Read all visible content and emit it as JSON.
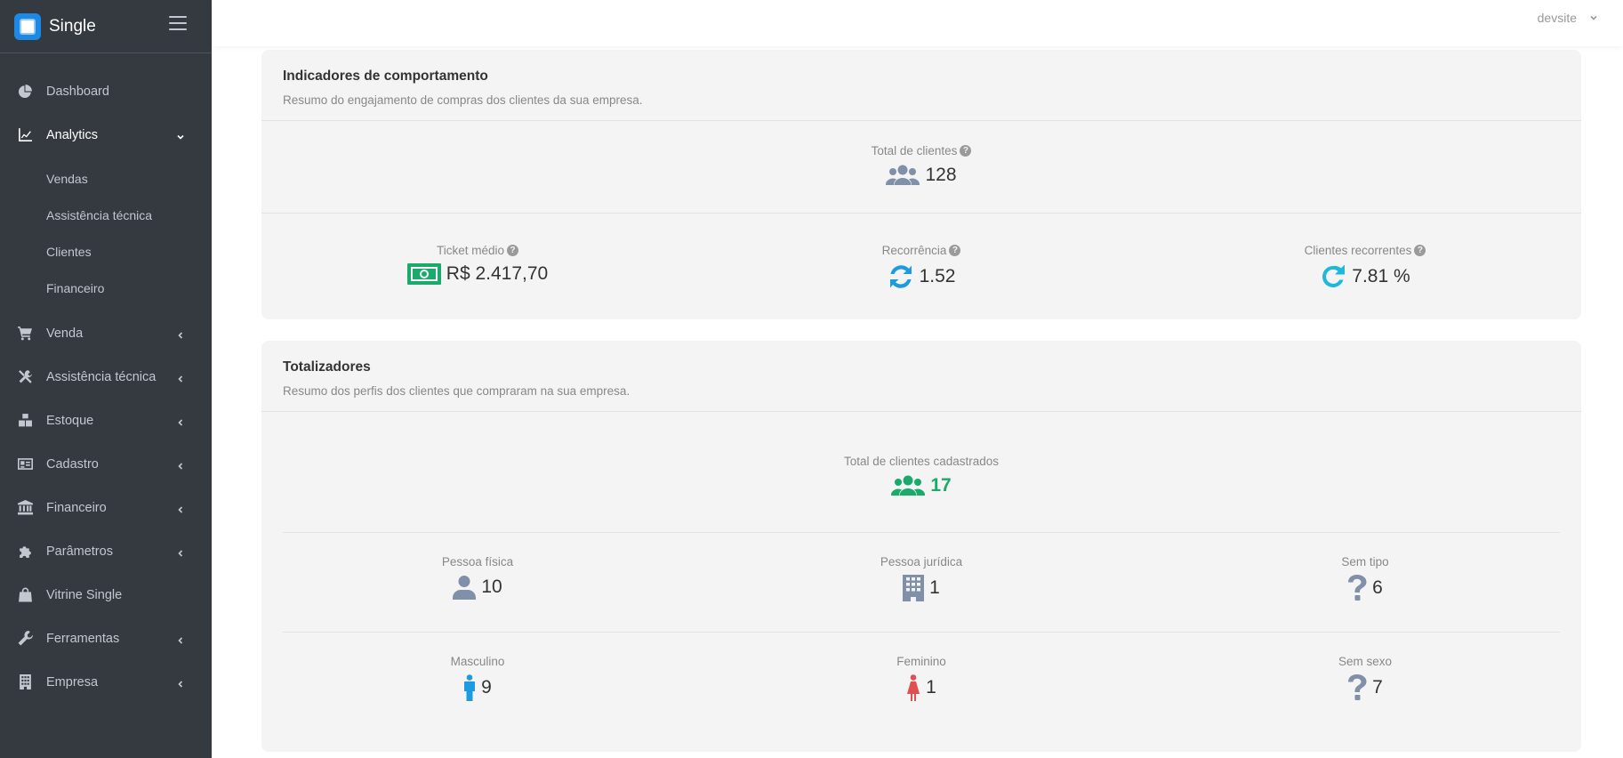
{
  "brand": {
    "name": "Single"
  },
  "sidebar": {
    "items": [
      {
        "label": "Dashboard",
        "icon": "pie-chart-icon",
        "arrow": ""
      },
      {
        "label": "Analytics",
        "icon": "line-chart-icon",
        "arrow": "down"
      },
      {
        "label": "Venda",
        "icon": "cart-icon",
        "arrow": "left"
      },
      {
        "label": "Assistência técnica",
        "icon": "tools-icon",
        "arrow": "left"
      },
      {
        "label": "Estoque",
        "icon": "boxes-icon",
        "arrow": "left"
      },
      {
        "label": "Cadastro",
        "icon": "id-card-icon",
        "arrow": "left"
      },
      {
        "label": "Financeiro",
        "icon": "bank-icon",
        "arrow": "left"
      },
      {
        "label": "Parâmetros",
        "icon": "puzzle-icon",
        "arrow": "left"
      },
      {
        "label": "Vitrine Single",
        "icon": "shopping-bag-icon",
        "arrow": ""
      },
      {
        "label": "Ferramentas",
        "icon": "wrench-icon",
        "arrow": "left"
      },
      {
        "label": "Empresa",
        "icon": "building-icon",
        "arrow": "left"
      }
    ],
    "analytics_sub": [
      "Vendas",
      "Assistência técnica",
      "Clientes",
      "Financeiro"
    ]
  },
  "topbar": {
    "user": "devsite"
  },
  "behavior": {
    "title": "Indicadores de comportamento",
    "subtitle": "Resumo do engajamento de compras dos clientes da sua empresa.",
    "total_label": "Total de clientes",
    "total_value": "128",
    "ticket_label": "Ticket médio",
    "ticket_value": "R$ 2.417,70",
    "recurrence_label": "Recorrência",
    "recurrence_value": "1.52",
    "recurring_label": "Clientes recorrentes",
    "recurring_value": "7.81 %"
  },
  "totals": {
    "title": "Totalizadores",
    "subtitle": "Resumo dos perfis dos clientes que compraram na sua empresa.",
    "registered_label": "Total de clientes cadastrados",
    "registered_value": "17",
    "pf_label": "Pessoa física",
    "pf_value": "10",
    "pj_label": "Pessoa jurídica",
    "pj_value": "1",
    "notype_label": "Sem tipo",
    "notype_value": "6",
    "male_label": "Masculino",
    "male_value": "9",
    "female_label": "Feminino",
    "female_value": "1",
    "nosex_label": "Sem sexo",
    "nosex_value": "7"
  },
  "colors": {
    "sidebar_bg": "#343a40",
    "green": "#1aaa6a",
    "blue": "#1e9be0",
    "red": "#e05050",
    "slate": "#8090a8"
  }
}
